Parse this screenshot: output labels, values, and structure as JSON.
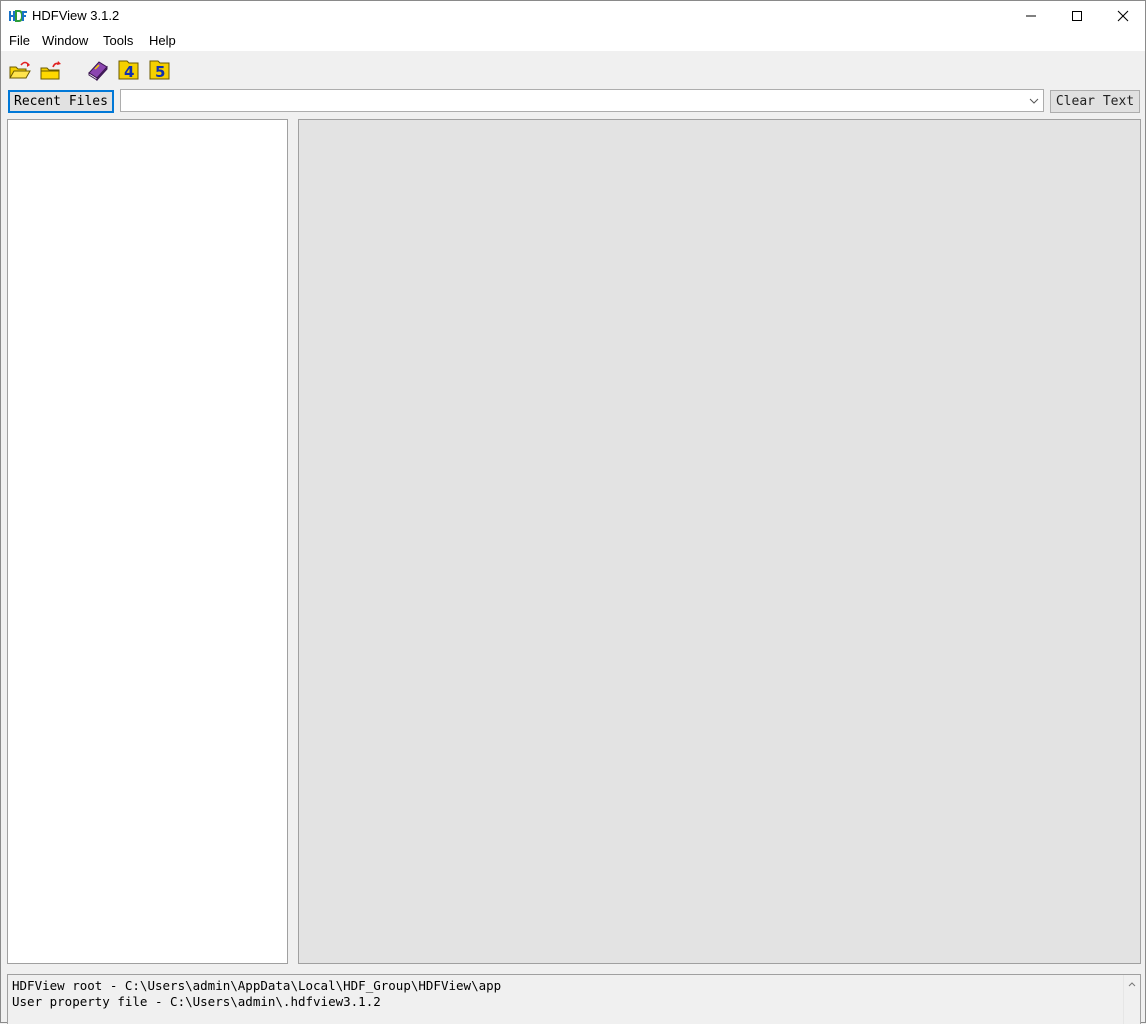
{
  "window": {
    "title": "HDFView 3.1.2",
    "app_icon": "hdf-logo-icon",
    "controls": [
      "minimize-icon",
      "maximize-icon",
      "close-icon"
    ]
  },
  "menubar": {
    "items": [
      {
        "label": "File"
      },
      {
        "label": "Window"
      },
      {
        "label": "Tools"
      },
      {
        "label": "Help"
      }
    ]
  },
  "toolbar": {
    "icons": [
      "open-folder-icon",
      "close-folder-icon",
      "users-guide-book-icon",
      "hdf4-library-icon",
      "hdf5-library-icon"
    ],
    "hdf4_glyph": "4",
    "hdf5_glyph": "5"
  },
  "recent": {
    "button_label": "Recent Files",
    "input_value": "",
    "clear_label": "Clear Text"
  },
  "log": {
    "lines": [
      "HDFView root - C:\\Users\\admin\\AppData\\Local\\HDF_Group\\HDFView\\app",
      "User property file - C:\\Users\\admin\\.hdfview3.1.2"
    ]
  },
  "colors": {
    "accent": "#0078d7",
    "folder_yellow": "#f5d000",
    "book_purple": "#7a3f9d",
    "content_bg": "#e3e3e3"
  }
}
